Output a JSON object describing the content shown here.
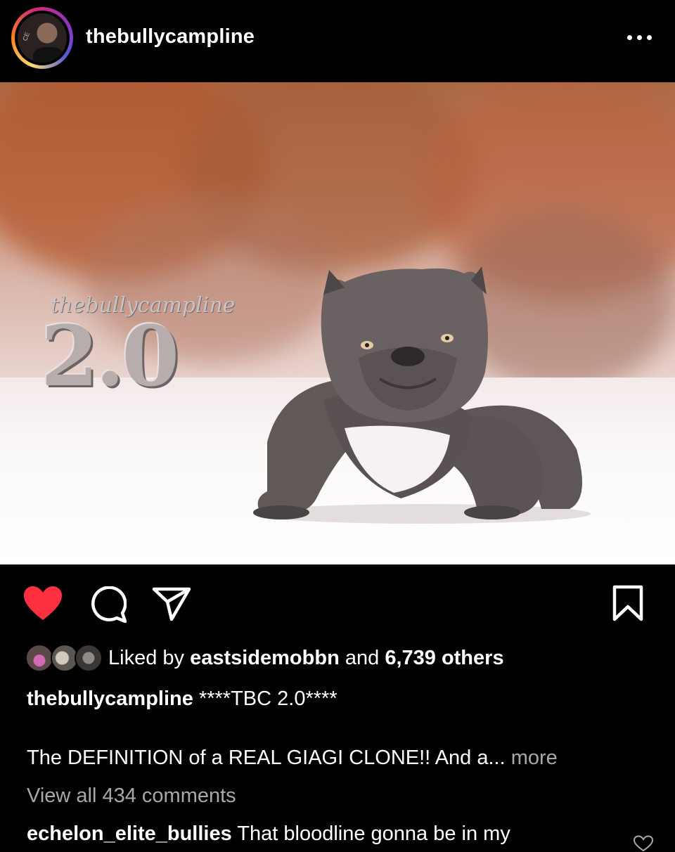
{
  "header": {
    "username": "thebullycampline",
    "avatar_badge": "CE",
    "more_icon": "more-horizontal-icon"
  },
  "photo": {
    "watermark_script": "thebullycampline",
    "watermark_number": "2.0"
  },
  "actions": {
    "like_icon": "heart-filled-icon",
    "comment_icon": "comment-bubble-icon",
    "share_icon": "paper-plane-icon",
    "save_icon": "bookmark-icon",
    "like_color": "#ff3040"
  },
  "likes": {
    "prefix": "Liked by",
    "user": "eastsidemobbn",
    "conjunction": "and",
    "count": "6,739 others"
  },
  "caption": {
    "username": "thebullycampline",
    "text": "****TBC 2.0****",
    "description": "The DEFINITION of a REAL GIAGI CLONE!! And a...",
    "more_label": "more"
  },
  "comments": {
    "view_all": "View all 434 comments",
    "first": {
      "username": "echelon_elite_bullies",
      "text": "That bloodline gonna be in my"
    }
  }
}
